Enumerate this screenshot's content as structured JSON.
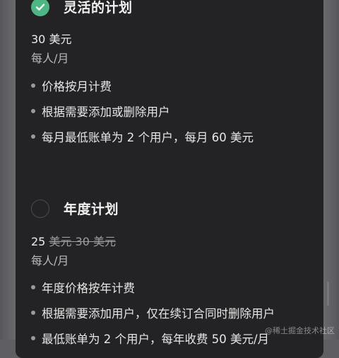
{
  "plans": [
    {
      "title": "灵活的计划",
      "selected": true,
      "price": "30 美元",
      "price_old": "",
      "period": "每人/月",
      "features": [
        "价格按月计费",
        "根据需要添加或删除用户",
        "每月最低账单为 2 个用户，每月 60 美元"
      ]
    },
    {
      "title": "年度计划",
      "selected": false,
      "price": "25",
      "price_old": "美元 30 美元",
      "period": "每人/月",
      "features": [
        "年度价格按年计费",
        "根据需要添加用户，仅在续订合同时删除用户",
        "最低账单为 2 个用户，每年收费 50 美元/月"
      ]
    }
  ],
  "colors": {
    "accent": "#4cb782",
    "card_bg": "#232325",
    "backdrop": "#5f5f63"
  },
  "icons": {
    "selected": "check-circle-icon",
    "unselected": "empty-radio-icon",
    "bullet": "bullet-dot"
  },
  "watermark": "@稀土掘金技术社区"
}
